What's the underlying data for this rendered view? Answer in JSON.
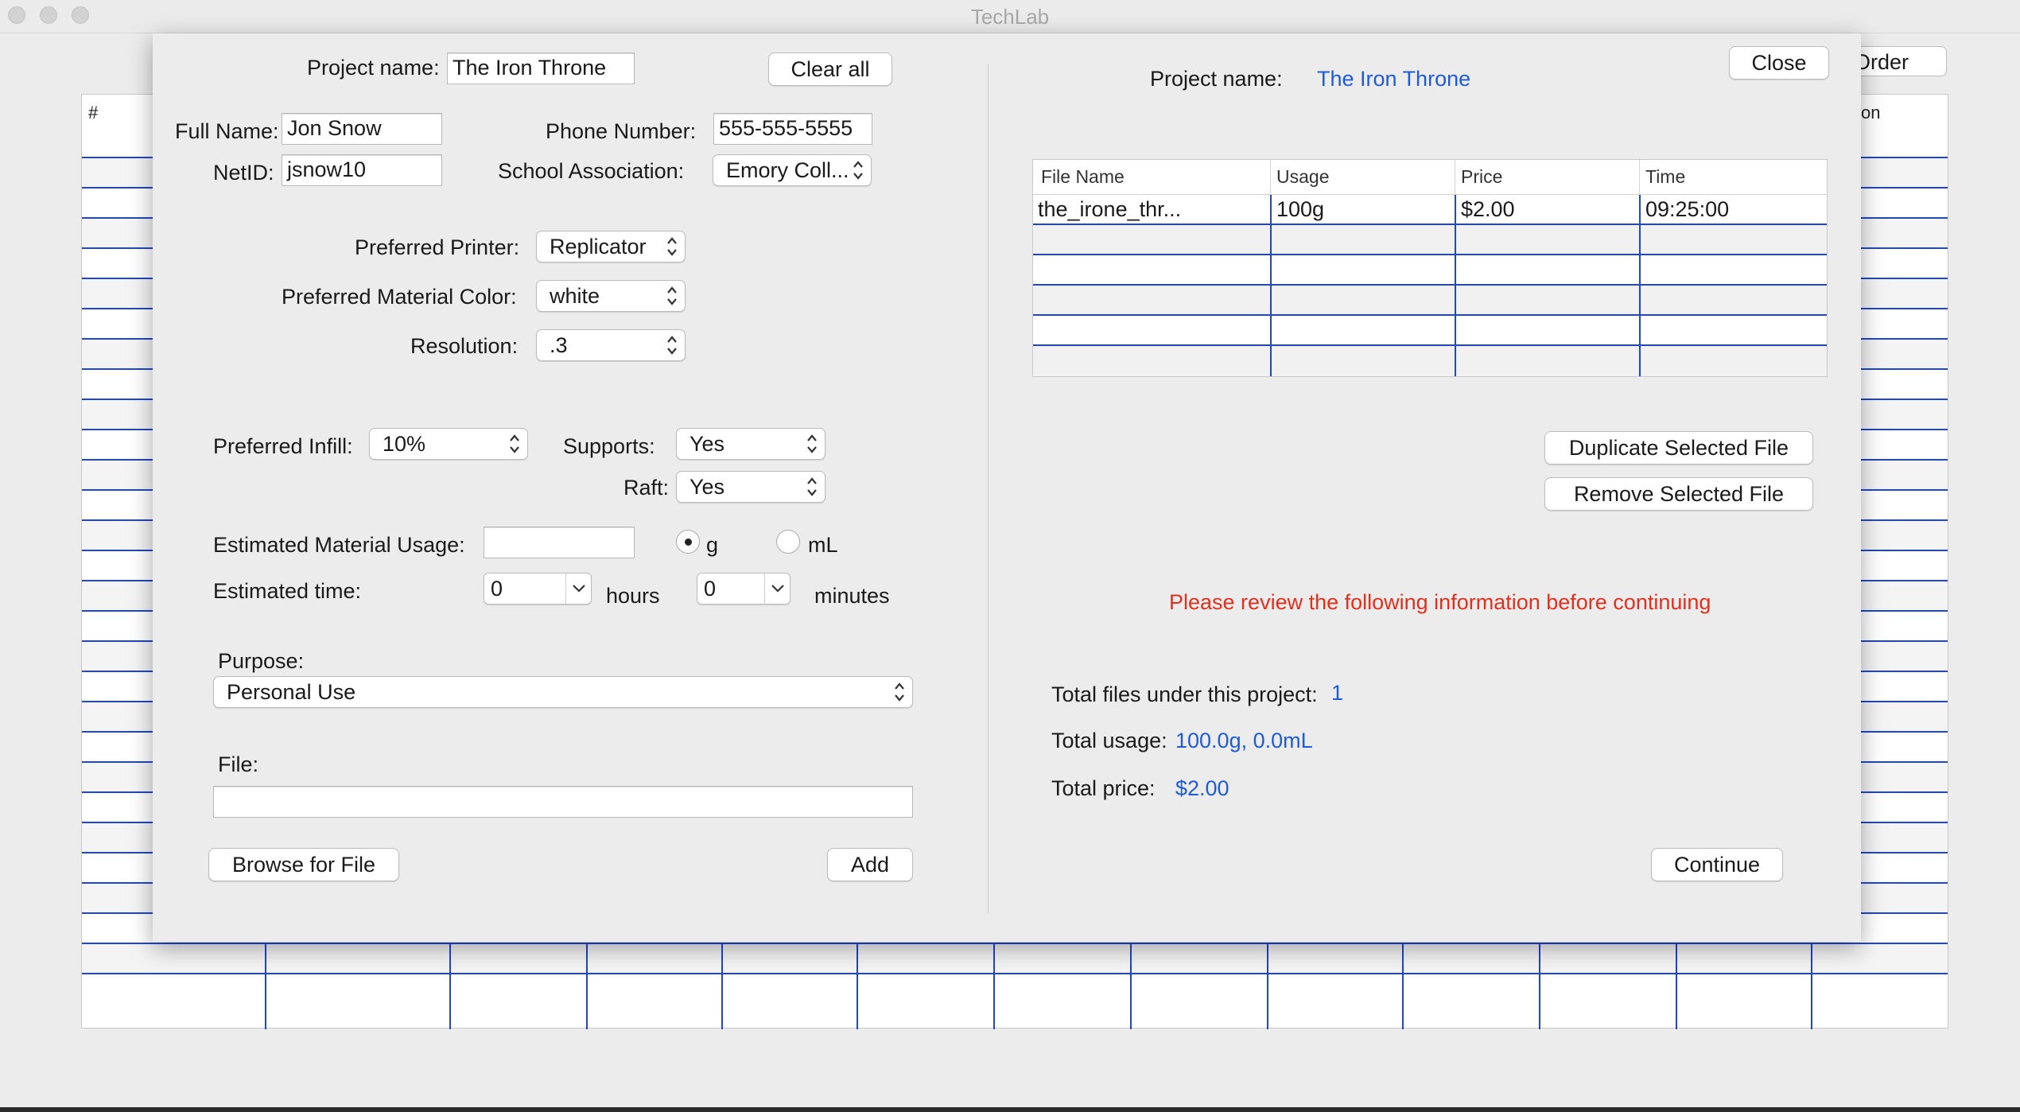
{
  "window": {
    "title": "TechLab",
    "bg_button_label": "Order",
    "bg_table": {
      "col_hash": "#",
      "col_right": "tion"
    }
  },
  "left": {
    "project_name_label": "Project name:",
    "project_name_value": "The Iron Throne",
    "clear_all": "Clear all",
    "full_name_label": "Full Name:",
    "full_name_value": "Jon Snow",
    "phone_label": "Phone Number:",
    "phone_value": "555-555-5555",
    "netid_label": "NetID:",
    "netid_value": "jsnow10",
    "school_label": "School Association:",
    "school_value": "Emory Coll...",
    "printer_label": "Preferred Printer:",
    "printer_value": "Replicator",
    "color_label": "Preferred Material Color:",
    "color_value": "white",
    "resolution_label": "Resolution:",
    "resolution_value": ".3",
    "infill_label": "Preferred Infill:",
    "infill_value": "10%",
    "supports_label": "Supports:",
    "supports_value": "Yes",
    "raft_label": "Raft:",
    "raft_value": "Yes",
    "usage_label": "Estimated Material Usage:",
    "usage_value": "",
    "unit_g": "g",
    "unit_ml": "mL",
    "unit_selected": "g",
    "time_label": "Estimated time:",
    "hours_value": "0",
    "hours_label": "hours",
    "minutes_value": "0",
    "minutes_label": "minutes",
    "purpose_label": "Purpose:",
    "purpose_value": "Personal Use",
    "file_label": "File:",
    "file_value": "",
    "browse_button": "Browse for File",
    "add_button": "Add"
  },
  "right": {
    "close_button": "Close",
    "project_name_label": "Project name:",
    "project_name_value": "The Iron Throne",
    "table": {
      "columns": [
        "File Name",
        "Usage",
        "Price",
        "Time"
      ],
      "rows": [
        [
          "the_irone_thr...",
          "100g",
          "$2.00",
          "09:25:00"
        ]
      ]
    },
    "duplicate_button": "Duplicate Selected File",
    "remove_button": "Remove Selected File",
    "review_message": "Please review the following information before continuing",
    "total_files_label": "Total files under this project:",
    "total_files_value": "1",
    "total_usage_label": "Total usage:",
    "total_usage_value": "100.0g, 0.0mL",
    "total_price_label": "Total price:",
    "total_price_value": "$2.00",
    "continue_button": "Continue"
  },
  "colors": {
    "accent_blue": "#1f5bd8",
    "warning_red": "#e0311f",
    "grid_blue": "#1f44d8"
  }
}
